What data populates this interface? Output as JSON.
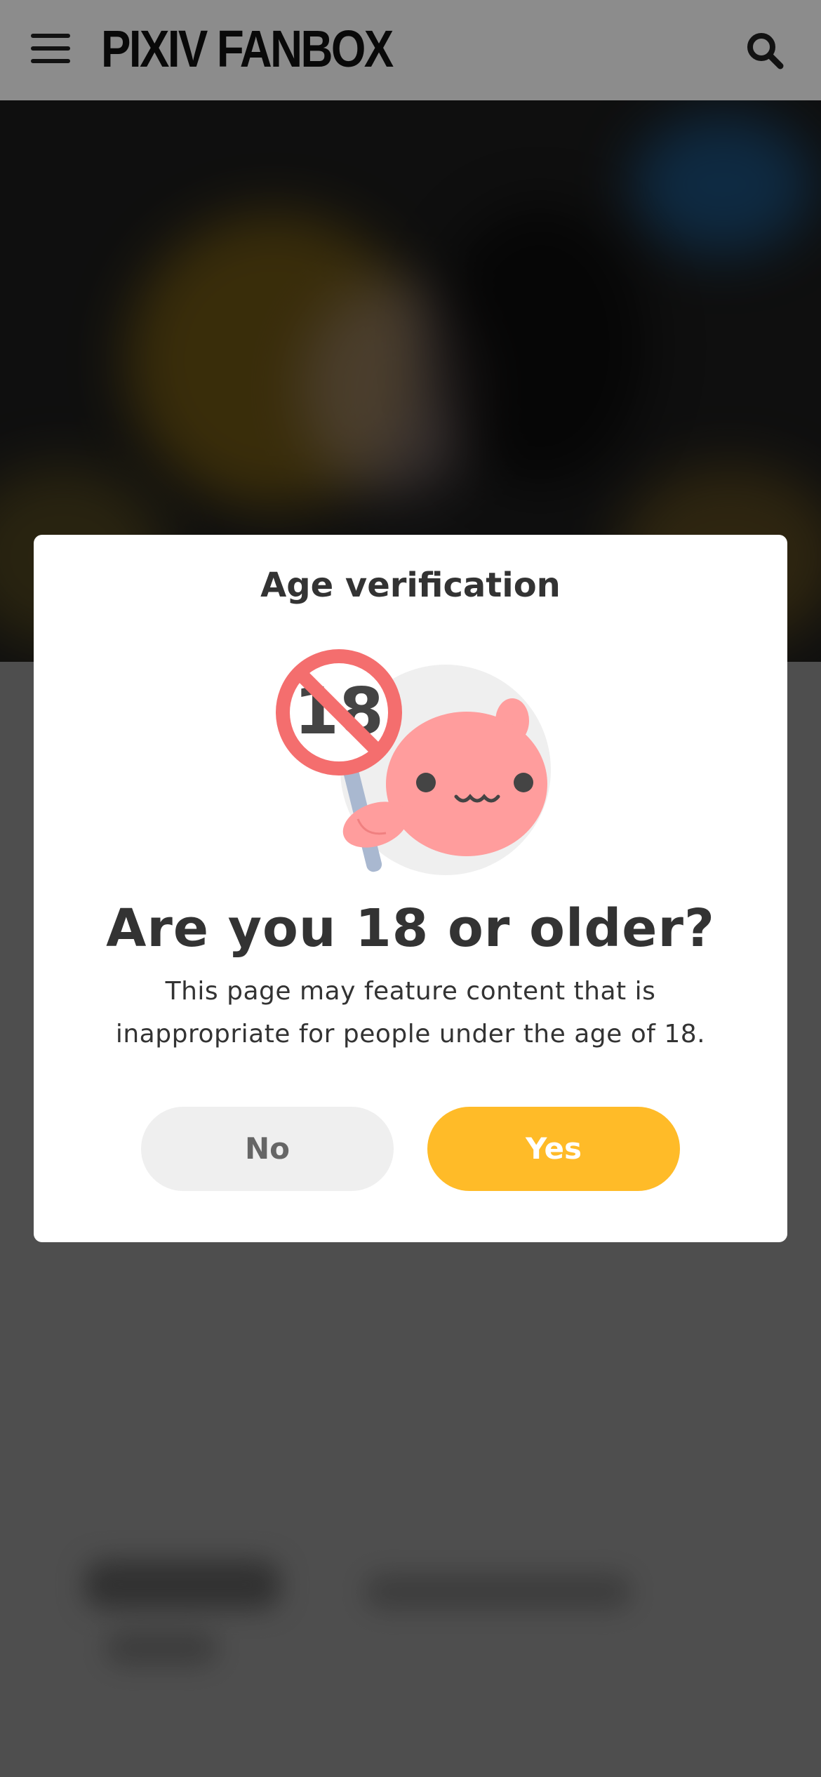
{
  "header": {
    "logo": "PIXIV FANBOX",
    "menu_icon": "hamburger-menu-icon",
    "search_icon": "search-icon"
  },
  "dialog": {
    "title": "Age verification",
    "illustration": "age-restriction-mascot-icon",
    "badge_number": "18",
    "question": "Are you 18 or older?",
    "description": "This page may feature content that is inappropriate for people under the age of 18.",
    "no_label": "No",
    "yes_label": "Yes"
  },
  "colors": {
    "accent_yes": "#ffbb28",
    "button_no_bg": "#efefef",
    "mascot_pink": "#ff9d9d",
    "badge_red": "#f46e6e",
    "text_dark": "#333333"
  }
}
